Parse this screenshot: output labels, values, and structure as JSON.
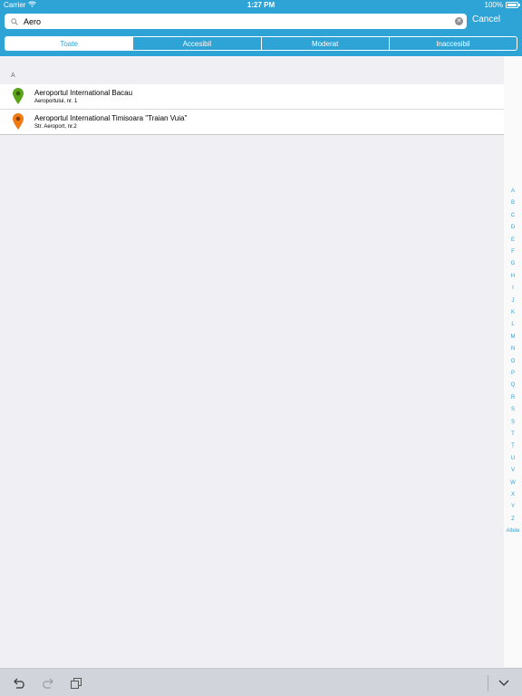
{
  "status_bar": {
    "carrier": "Carrier",
    "time": "1:27 PM",
    "battery": "100%"
  },
  "search": {
    "value": "Aero",
    "placeholder": "",
    "cancel_label": "Cancel"
  },
  "filters": [
    {
      "label": "Toate",
      "active": true
    },
    {
      "label": "Accesibil",
      "active": false
    },
    {
      "label": "Moderat",
      "active": false
    },
    {
      "label": "Inaccesibil",
      "active": false
    }
  ],
  "results": {
    "section": "A",
    "items": [
      {
        "title": "Aeroportul International Bacau",
        "subtitle": "Aeroportului, nr. 1",
        "pin_color": "#5aa21a",
        "pin_icon": "map-pin-green-icon"
      },
      {
        "title": "Aeroportul International Timisoara \"Traian Vuia\"",
        "subtitle": "Str. Aeroport, nr.2",
        "pin_color": "#f07a13",
        "pin_icon": "map-pin-orange-icon"
      }
    ]
  },
  "index": [
    "A",
    "B",
    "C",
    "D",
    "E",
    "F",
    "G",
    "H",
    "I",
    "J",
    "K",
    "L",
    "M",
    "N",
    "O",
    "P",
    "Q",
    "R",
    "S",
    "Ș",
    "T",
    "Ț",
    "U",
    "V",
    "W",
    "X",
    "Y",
    "Z",
    "Altele"
  ],
  "colors": {
    "accent": "#2ea3d6",
    "background": "#efeff4",
    "toolbar": "#d1d5db"
  }
}
